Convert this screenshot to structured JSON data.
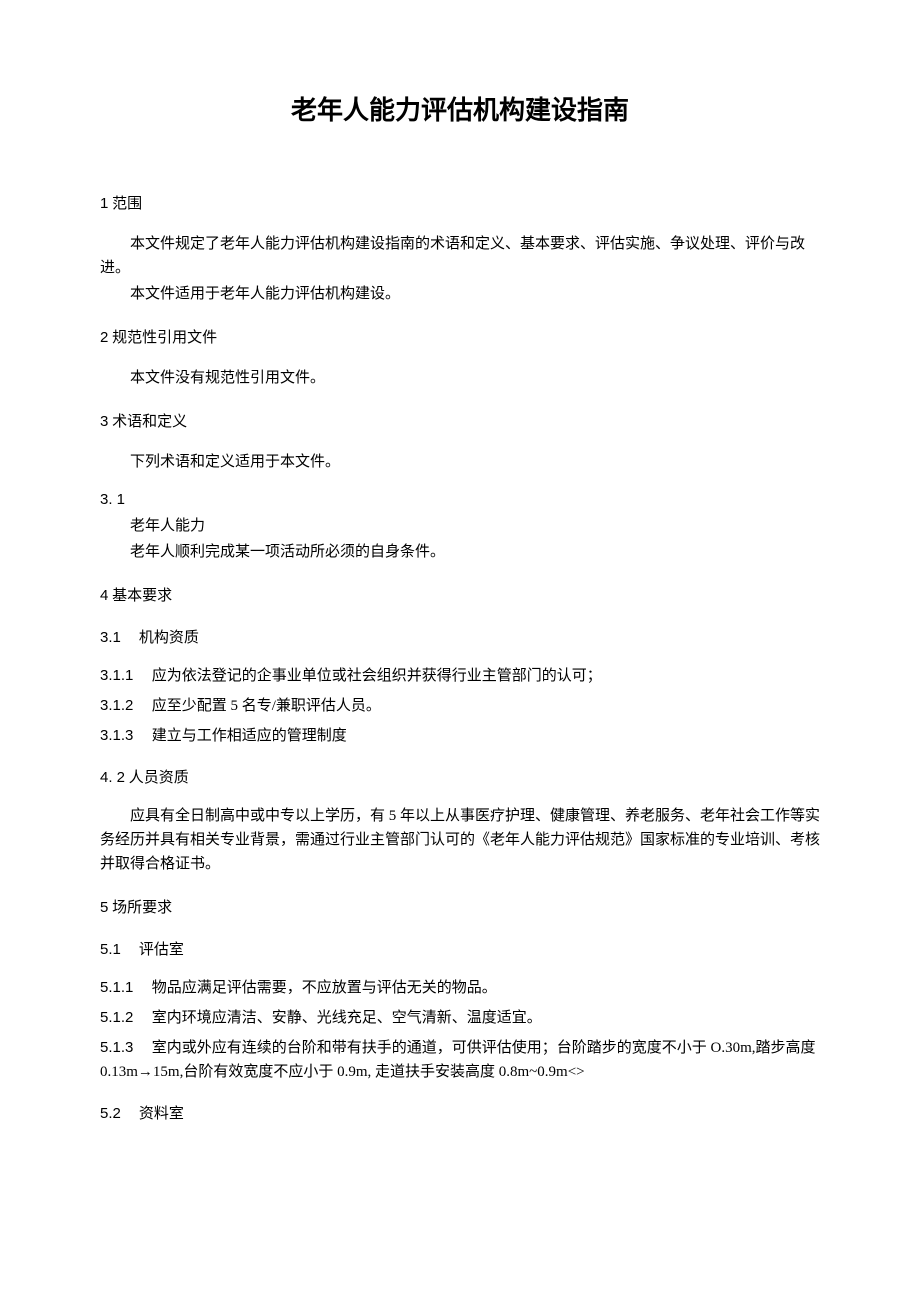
{
  "title": "老年人能力评估机构建设指南",
  "s1": {
    "heading_num": "1",
    "heading_text": "范围",
    "p1": "本文件规定了老年人能力评估机构建设指南的术语和定义、基本要求、评估实施、争议处理、评价与改进。",
    "p2": "本文件适用于老年人能力评估机构建设。"
  },
  "s2": {
    "heading_num": "2",
    "heading_text": "规范性引用文件",
    "p1": "本文件没有规范性引用文件。"
  },
  "s3": {
    "heading_num": "3",
    "heading_text": "术语和定义",
    "p1": "下列术语和定义适用于本文件。",
    "term_num": "3.   1",
    "term_name": "老年人能力",
    "term_def": "老年人顺利完成某一项活动所必须的自身条件。"
  },
  "s4": {
    "heading_num": "4",
    "heading_text": "基本要求",
    "sub31": {
      "num": "3.1",
      "text": "机构资质"
    },
    "c311_num": "3.1.1",
    "c311": "应为依法登记的企事业单位或社会组织并获得行业主管部门的认可；",
    "c312_num": "3.1.2",
    "c312": "应至少配置 5 名专/兼职评估人员。",
    "c313_num": "3.1.3",
    "c313": "建立与工作相适应的管理制度",
    "sub42": {
      "num": "4.   2",
      "text": "人员资质"
    },
    "p42": "应具有全日制高中或中专以上学历，有 5 年以上从事医疗护理、健康管理、养老服务、老年社会工作等实务经历并具有相关专业背景，需通过行业主管部门认可的《老年人能力评估规范》国家标准的专业培训、考核并取得合格证书。"
  },
  "s5": {
    "heading_num": "5",
    "heading_text": "场所要求",
    "sub51": {
      "num": "5.1",
      "text": "评估室"
    },
    "c511_num": "5.1.1",
    "c511": "物品应满足评估需要，不应放置与评估无关的物品。",
    "c512_num": "5.1.2",
    "c512": "室内环境应清洁、安静、光线充足、空气清新、温度适宜。",
    "c513_num": "5.1.3",
    "c513": "室内或外应有连续的台阶和带有扶手的通道，可供评估使用；台阶踏步的宽度不小于 O.30m,踏步高度 0.13m→15m,台阶有效宽度不应小于 0.9m, 走道扶手安装高度 0.8m~0.9m<>",
    "sub52": {
      "num": "5.2",
      "text": "资料室"
    }
  }
}
